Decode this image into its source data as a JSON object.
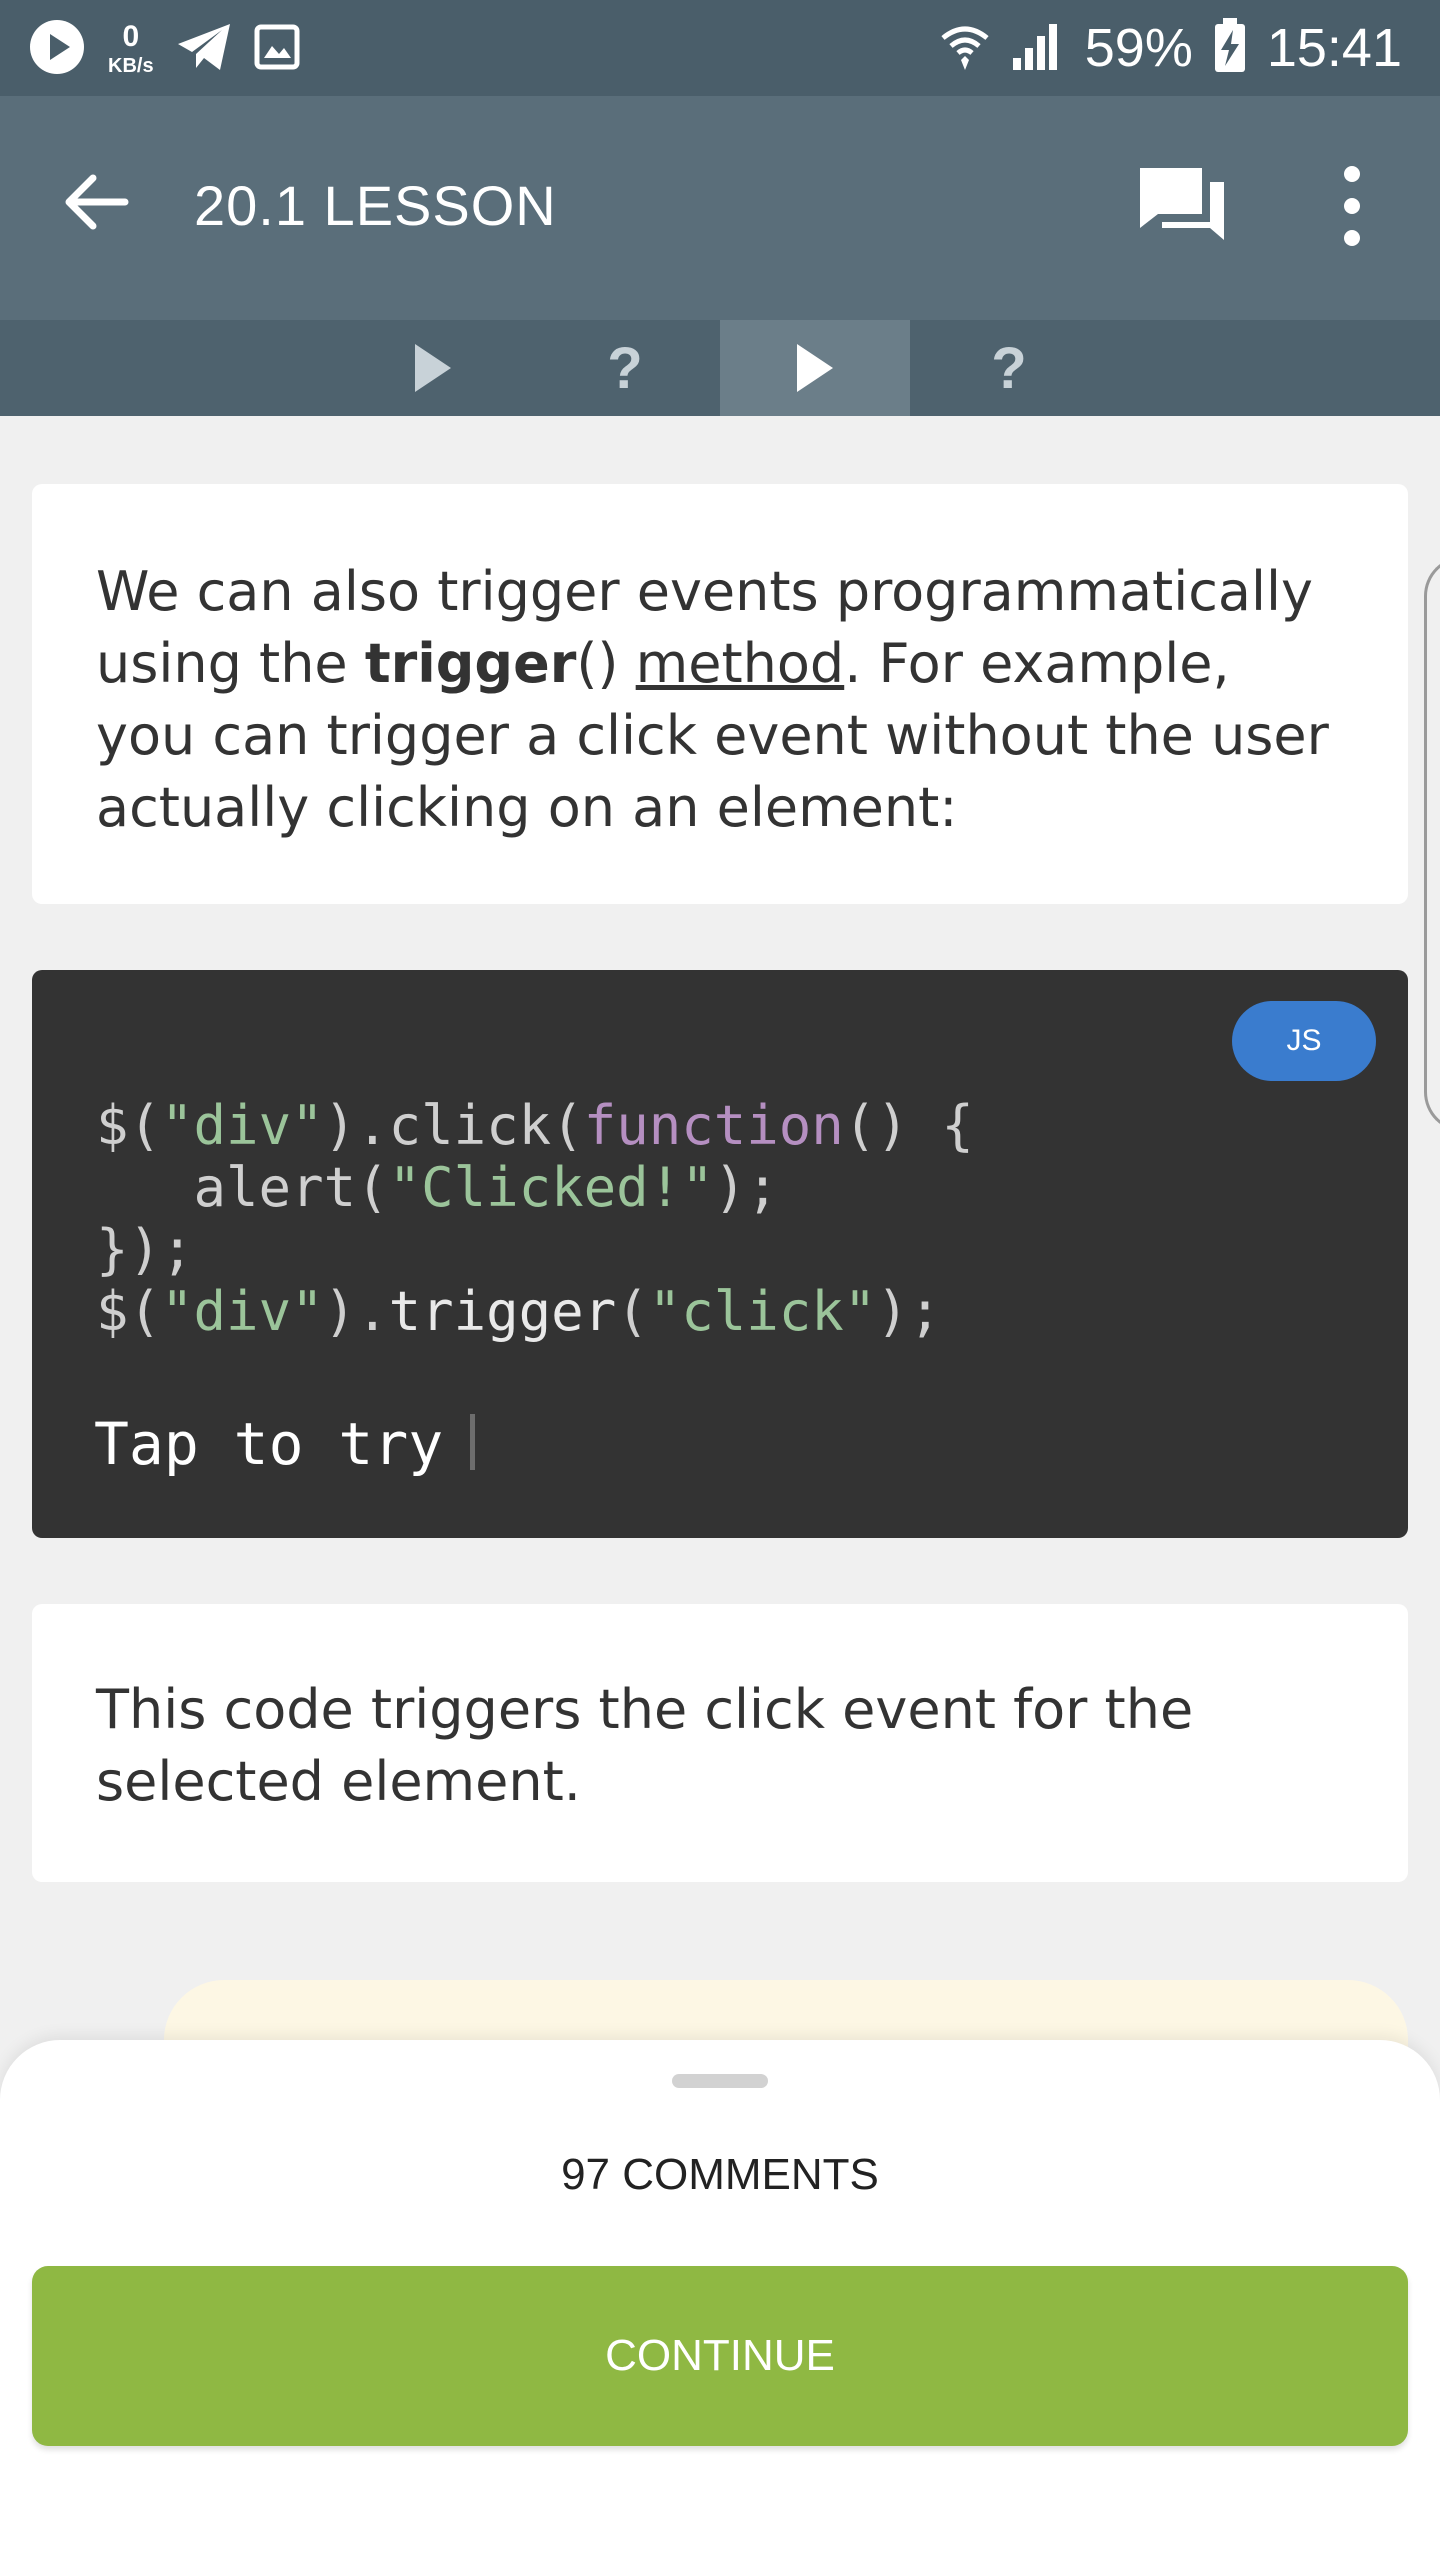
{
  "status_bar": {
    "speed_value": "0",
    "speed_unit": "KB/s",
    "battery": "59%",
    "time": "15:41"
  },
  "app_bar": {
    "title": "20.1 LESSON",
    "icons": [
      "back-arrow-icon",
      "chat-icon",
      "more-vert-icon"
    ]
  },
  "tabs": [
    {
      "type": "play"
    },
    {
      "label": "?"
    },
    {
      "type": "play",
      "active": true
    },
    {
      "label": "?"
    }
  ],
  "content": {
    "intro": {
      "part1": "We can also trigger events programmatically using the ",
      "keyword": "trigger",
      "paren": "()",
      "space": " ",
      "link": "method",
      "part2": ". For example, you can trigger a click event without the user actually clicking on an element:"
    },
    "code": {
      "language": "JS",
      "line1": {
        "a": "$(",
        "b": "\"div\"",
        "c": ").click(",
        "d": "function",
        "e": "() {"
      },
      "line2": {
        "a": "   alert(",
        "b": "\"Clicked!\"",
        "c": ");"
      },
      "line3": "});",
      "line4": {
        "a": "$(",
        "b": "\"div\"",
        "c": ").",
        "d": "trigger",
        "e": "(",
        "f": "\"click\"",
        "g": ");"
      },
      "try_label": "Tap to try"
    },
    "explanation": "This code triggers the click event for the selected element."
  },
  "bottom_sheet": {
    "comments_label": "97 COMMENTS",
    "continue_label": "CONTINUE"
  },
  "colors": {
    "app_bar": "#5a6e7a",
    "accent_green": "#8fb843",
    "badge_blue": "#3a7cce"
  }
}
